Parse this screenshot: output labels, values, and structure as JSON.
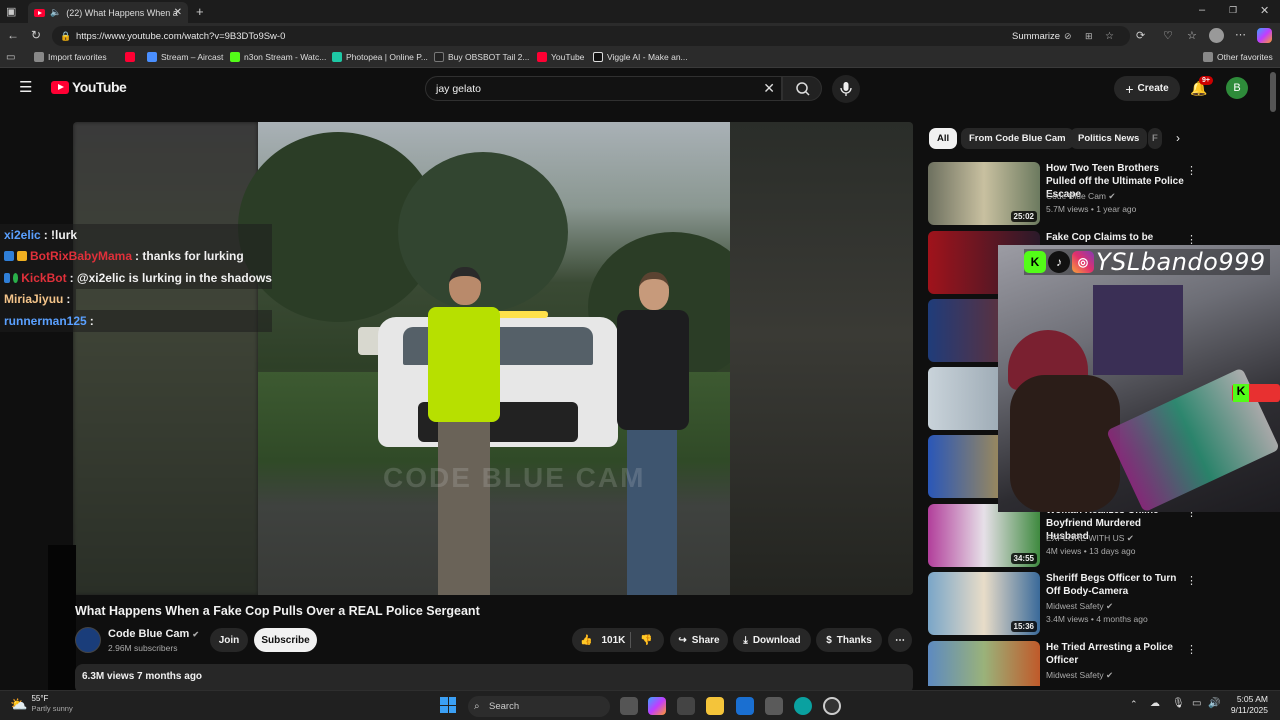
{
  "browser": {
    "tab_title": "(22) What Happens When a",
    "url": "https://www.youtube.com/watch?v=9B3DTo9Sw-0",
    "summarize_label": "Summarize",
    "bookmarks": [
      "Import favorites",
      "Stream – Aircast",
      "n3on Stream - Watc...",
      "Photopea | Online P...",
      "Buy OBSBOT Tail 2...",
      "YouTube",
      "Viggle AI - Make an..."
    ],
    "other_favorites": "Other favorites"
  },
  "youtube": {
    "logo": "YouTube",
    "search_query": "jay gelato",
    "create_label": "Create",
    "notif_badge": "9+",
    "avatar_letter": "B"
  },
  "chat": [
    {
      "user": "xi2elic",
      "user_color": "#5aa0ff",
      "message": ": !lurk"
    },
    {
      "user": "BotRixBabyMama",
      "user_color": "#e0303a",
      "message": ": thanks for lurking"
    },
    {
      "user": "KickBot",
      "user_color": "#e0303a",
      "message": ": @xi2elic is lurking in the shadows"
    },
    {
      "user": "MiriaJiyuu",
      "user_color": "#f4c48a",
      "message": ":"
    },
    {
      "user": "runnerman125",
      "user_color": "#5aa0ff",
      "message": ":"
    }
  ],
  "video": {
    "watermark": "CODE BLUE CAM",
    "title": "What Happens When a Fake Cop Pulls Over a REAL Police Sergeant",
    "channel": "Code Blue Cam",
    "subscribers": "2.96M subscribers",
    "join_label": "Join",
    "subscribe_label": "Subscribe",
    "likes": "101K",
    "share_label": "Share",
    "download_label": "Download",
    "thanks_label": "Thanks",
    "views_date": "6.3M views  7 months ago"
  },
  "chips": [
    "All",
    "From Code Blue Cam",
    "Politics News",
    "F"
  ],
  "recommendations": [
    {
      "title": "How Two Teen Brothers Pulled off the Ultimate Police Escape",
      "channel": "Code Blue Cam",
      "meta": "5.7M views • 1 year ago",
      "duration": "25:02"
    },
    {
      "title": "Fake Cop Claims to be Special",
      "channel": "",
      "meta": "",
      "duration": ""
    },
    {
      "title": "",
      "channel": "",
      "meta": "",
      "duration": ""
    },
    {
      "title": "",
      "channel": "",
      "meta": "",
      "duration": ""
    },
    {
      "title": "",
      "channel": "",
      "meta": "",
      "duration": ""
    },
    {
      "title": "Woman Realizes Online Boyfriend Murdered Husband",
      "channel": "EXPLORE WITH US",
      "meta": "4M views • 13 days ago",
      "duration": "34:55"
    },
    {
      "title": "Sheriff Begs Officer to Turn Off Body-Camera",
      "channel": "Midwest Safety",
      "meta": "3.4M views • 4 months ago",
      "duration": "15:36"
    },
    {
      "title": "He Tried Arresting a Police Officer",
      "channel": "Midwest Safety",
      "meta": "",
      "duration": ""
    }
  ],
  "webcam": {
    "name": "YSLbando999"
  },
  "taskbar": {
    "weather_temp": "55°F",
    "weather_desc": "Partly sunny",
    "search_label": "Search",
    "time": "5:05 AM",
    "date": "9/11/2025"
  }
}
